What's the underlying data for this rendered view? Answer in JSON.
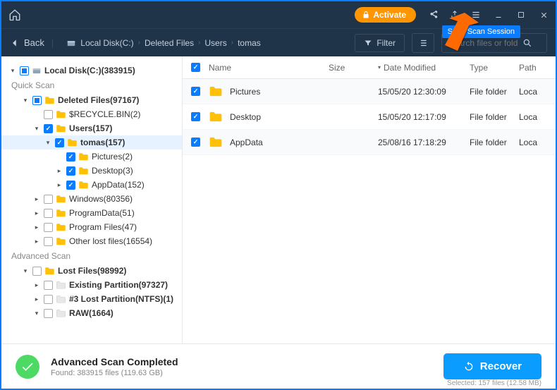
{
  "titlebar": {
    "activate_label": "Activate"
  },
  "tooltip": {
    "text": "Save Scan Session"
  },
  "navbar": {
    "back_label": "Back",
    "crumbs": [
      "Local Disk(C:)",
      "Deleted Files",
      "Users",
      "tomas"
    ],
    "filter_label": "Filter",
    "search_placeholder": "Search files or folders"
  },
  "sidebar": {
    "root": "Local Disk(C:)(383915)",
    "quick_scan_label": "Quick Scan",
    "deleted_files": "Deleted Files(97167)",
    "recycle": "$RECYCLE.BIN(2)",
    "users": "Users(157)",
    "tomas": "tomas(157)",
    "pictures": "Pictures(2)",
    "desktop": "Desktop(3)",
    "appdata": "AppData(152)",
    "windows": "Windows(80356)",
    "programdata": "ProgramData(51)",
    "programfiles": "Program Files(47)",
    "otherlost": "Other lost files(16554)",
    "advanced_scan_label": "Advanced Scan",
    "lostfiles": "Lost Files(98992)",
    "existing": "Existing Partition(97327)",
    "lost3": "#3 Lost Partition(NTFS)(1)",
    "raw": "RAW(1664)"
  },
  "list": {
    "header": {
      "name": "Name",
      "size": "Size",
      "date": "Date Modified",
      "type": "Type",
      "path": "Path"
    },
    "rows": [
      {
        "name": "Pictures",
        "size": "",
        "date": "15/05/20 12:30:09",
        "type": "File folder",
        "path": "Loca"
      },
      {
        "name": "Desktop",
        "size": "",
        "date": "15/05/20 12:17:09",
        "type": "File folder",
        "path": "Loca"
      },
      {
        "name": "AppData",
        "size": "",
        "date": "25/08/16 17:18:29",
        "type": "File folder",
        "path": "Loca"
      }
    ]
  },
  "footer": {
    "title": "Advanced Scan Completed",
    "sub": "Found: 383915 files (119.63 GB)",
    "recover_label": "Recover",
    "selected": "Selected: 157 files (12.58 MB)"
  }
}
